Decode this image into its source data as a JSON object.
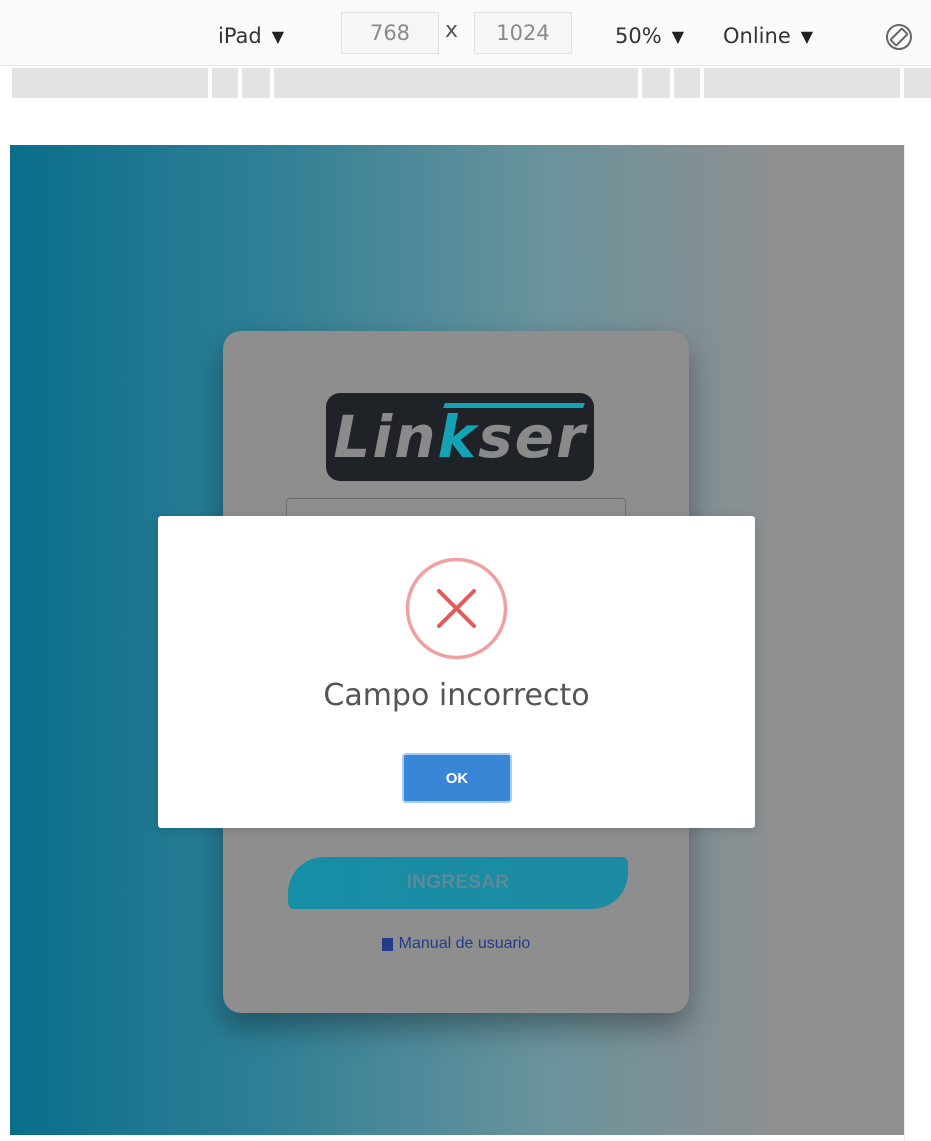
{
  "devtools": {
    "device": "iPad",
    "width": "768",
    "times": "x",
    "height": "1024",
    "zoom": "50%",
    "network": "Online",
    "rotate_icon": "rotate-icon"
  },
  "login": {
    "logo_prefix": "Lin",
    "logo_accent": "k",
    "logo_suffix": "ser",
    "submit_label": "INGRESAR",
    "manual_label": "Manual de usuario"
  },
  "modal": {
    "icon": "error-x-icon",
    "title": "Campo incorrecto",
    "ok_label": "OK"
  },
  "colors": {
    "accent": "#14a3b5",
    "ok_button": "#3a86d6",
    "error_red": "#e15b5b"
  }
}
